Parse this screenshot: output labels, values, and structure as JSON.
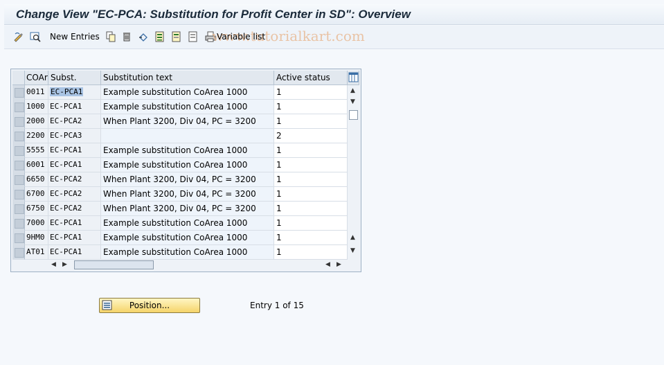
{
  "window": {
    "title": "Change View \"EC-PCA: Substitution for Profit Center in SD\": Overview"
  },
  "toolbar": {
    "new_entries_label": "New Entries",
    "variable_list_label": "Variable list",
    "watermark": "www.tutorialkart.com"
  },
  "table": {
    "columns": [
      "COAr",
      "Subst.",
      "Substitution text",
      "Active status"
    ],
    "rows": [
      {
        "coar": "0011",
        "subst": "EC-PCA1",
        "text": "Example substitution CoArea 1000",
        "active": "1"
      },
      {
        "coar": "1000",
        "subst": "EC-PCA1",
        "text": "Example substitution CoArea 1000",
        "active": "1"
      },
      {
        "coar": "2000",
        "subst": "EC-PCA2",
        "text": "When Plant 3200, Div 04, PC = 3200",
        "active": "1"
      },
      {
        "coar": "2200",
        "subst": "EC-PCA3",
        "text": "",
        "active": "2"
      },
      {
        "coar": "5555",
        "subst": "EC-PCA1",
        "text": "Example substitution CoArea 1000",
        "active": "1"
      },
      {
        "coar": "6001",
        "subst": "EC-PCA1",
        "text": "Example substitution CoArea 1000",
        "active": "1"
      },
      {
        "coar": "6650",
        "subst": "EC-PCA2",
        "text": "When Plant 3200, Div 04, PC = 3200",
        "active": "1"
      },
      {
        "coar": "6700",
        "subst": "EC-PCA2",
        "text": "When Plant 3200, Div 04, PC = 3200",
        "active": "1"
      },
      {
        "coar": "6750",
        "subst": "EC-PCA2",
        "text": "When Plant 3200, Div 04, PC = 3200",
        "active": "1"
      },
      {
        "coar": "7000",
        "subst": "EC-PCA1",
        "text": "Example substitution CoArea 1000",
        "active": "1"
      },
      {
        "coar": "9HM0",
        "subst": "EC-PCA1",
        "text": "Example substitution CoArea 1000",
        "active": "1"
      },
      {
        "coar": "AT01",
        "subst": "EC-PCA1",
        "text": "Example substitution CoArea 1000",
        "active": "1"
      }
    ]
  },
  "footer": {
    "position_button_label": "Position...",
    "entry_info": "Entry 1 of 15"
  },
  "colors": {
    "button_yellow": "#f5d46a",
    "selection_highlight": "#a9c4e4",
    "table_border": "#9db0c4"
  }
}
